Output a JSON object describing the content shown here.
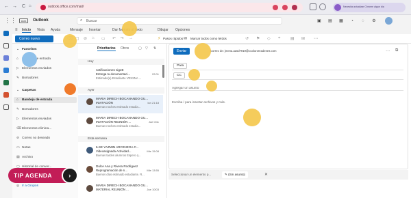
{
  "browser": {
    "url": "outlook.office.com/mail/",
    "profile_text": "Necesita actualizar Chrome algun dia"
  },
  "header": {
    "app_badge": "M365",
    "app_title": "Outlook",
    "search_placeholder": "Buscar"
  },
  "ribbon": {
    "tabs": [
      "Inicio",
      "Vista",
      "Ayuda",
      "Mensaje",
      "Insertar",
      "Dar formato al texto",
      "Dibujar",
      "Opciones"
    ],
    "new_mail": "Correo nuevo",
    "quick_steps": "Pasos rápidos",
    "mark_all_read": "Marcar todos como leídos"
  },
  "folders": {
    "favorites_header": "Favoritos",
    "favorites": [
      "Bandeja de entrada",
      "Elementos enviados",
      "Borradores"
    ],
    "folders_header": "Carpetas",
    "folders": [
      "Bandeja de entrada",
      "Borradores",
      "Elementos enviados",
      "Elementos elimina...",
      "Correo no deseado",
      "Notas",
      "Archivo",
      "Historial de conver..."
    ],
    "last_item": "Ir a Grupos"
  },
  "message_list": {
    "tabs": [
      "Prioritarios",
      "Otros"
    ],
    "groups": [
      "Hoy",
      "Ayer",
      "Esta semana"
    ],
    "messages": [
      {
        "sender": "notificaciones sigeE",
        "subject": "Entrega tu documentaci...",
        "preview": "Estimado(a) Estudiante VESSNA ...",
        "date": "22:01"
      },
      {
        "sender": "MARIA DIRECH BOCANANDO GU...",
        "subject": "INVITACIÓN",
        "preview": "Buenas noches estimado estudia...",
        "date": "lun 21:18"
      },
      {
        "sender": "MARIA DIRECH BOCANANDO GU...",
        "subject": "INVITACIÓN REUNIÓN ...",
        "preview": "Buenas noches estimado estudia...",
        "date": "Jue 0/11"
      },
      {
        "sender": "ILSE YAZMIN ARCINIEGA C...",
        "subject": "Videoasignada Actividad...",
        "preview": "Buenas tardes alumnos Espero q...",
        "date": "Mie 15:08"
      },
      {
        "sender": "Dulce Ana y Rivera Rodriguez",
        "subject": "Reprogramación de n...",
        "preview": "Buenos días estimado estudiante. R...",
        "date": "Mie 13:55"
      },
      {
        "sender": "MARIA DIRECH BOCANANDO GU...",
        "subject": "MATERIAL REUNIÓN ...",
        "preview": "",
        "date": "Jue 10/03"
      }
    ]
  },
  "compose": {
    "send": "Enviar",
    "from": "Correo de: jmena.aasd7919@cuoluroreadenes.com",
    "to_label": "Para",
    "cc_label": "CC",
    "subject_placeholder": "Agregar un asunto",
    "body_placeholder": "Escriba / para insertar archivos y más."
  },
  "draft_bar": {
    "select_item": "Seleccionar un elemento p...",
    "no_subject": "(Sin asunto)",
    "close": "✕"
  },
  "overlay": {
    "tip_agenda": "TIP AGENDA",
    "play": "›"
  }
}
